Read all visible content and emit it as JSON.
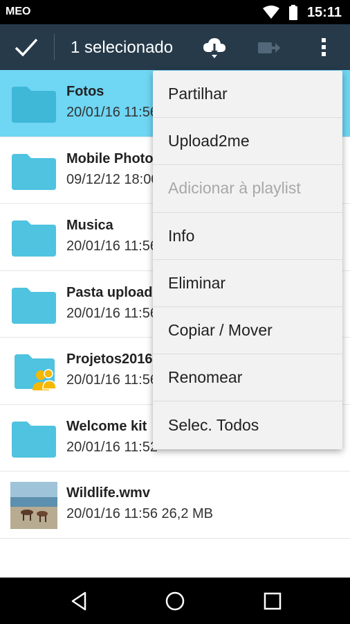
{
  "status_bar": {
    "carrier": "MEO",
    "time": "15:11"
  },
  "action_bar": {
    "selection_title": "1 selecionado"
  },
  "files": [
    {
      "name": "Fotos",
      "meta": "20/01/16 11:56",
      "icon": "folder-icon",
      "selected": true
    },
    {
      "name": "Mobile Photos",
      "meta": "09/12/12 18:00",
      "icon": "folder-icon",
      "selected": false
    },
    {
      "name": "Musica",
      "meta": "20/01/16 11:56",
      "icon": "folder-icon",
      "selected": false
    },
    {
      "name": "Pasta upload",
      "meta": "20/01/16 11:56",
      "icon": "folder-icon",
      "selected": false
    },
    {
      "name": "Projetos2016",
      "meta": "20/01/16 11:56",
      "icon": "shared-folder-icon",
      "selected": false
    },
    {
      "name": "Welcome kit",
      "meta": "20/01/16 11:52",
      "icon": "folder-icon",
      "selected": false
    },
    {
      "name": "Wildlife.wmv",
      "meta": "20/01/16 11:56   26,2 MB",
      "icon": "video-thumbnail",
      "selected": false
    }
  ],
  "context_menu": [
    {
      "label": "Partilhar",
      "enabled": true
    },
    {
      "label": "Upload2me",
      "enabled": true
    },
    {
      "label": "Adicionar à playlist",
      "enabled": false
    },
    {
      "label": "Info",
      "enabled": true
    },
    {
      "label": "Eliminar",
      "enabled": true
    },
    {
      "label": "Copiar / Mover",
      "enabled": true
    },
    {
      "label": "Renomear",
      "enabled": true
    },
    {
      "label": "Selec. Todos",
      "enabled": true
    }
  ],
  "colors": {
    "action_bar": "#263a4a",
    "selected_row": "#6fd6f4",
    "folder": "#4fc3e0"
  }
}
